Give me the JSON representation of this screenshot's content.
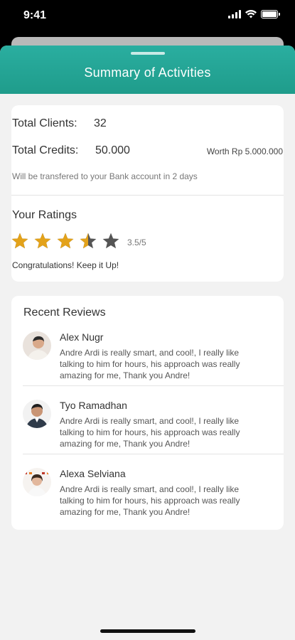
{
  "status_bar": {
    "time": "9:41"
  },
  "header": {
    "title": "Summary of Activities"
  },
  "summary": {
    "clients_label": "Total Clients:",
    "clients_value": "32",
    "credits_label": "Total Credits:",
    "credits_value": "50.000",
    "worth": "Worth Rp 5.000.000",
    "transfer_note": "Will be transfered to your Bank account in 2 days"
  },
  "ratings": {
    "title": "Your Ratings",
    "score": 3.5,
    "max": 5,
    "score_text": "3.5/5",
    "message": "Congratulations! Keep it Up!",
    "star_color": "#e3a21a",
    "star_empty_color": "#555555"
  },
  "reviews": {
    "title": "Recent Reviews",
    "items": [
      {
        "name": "Alex Nugr",
        "text": "Andre Ardi is really smart, and cool!, I really like talking to him for hours, his approach was really amazing for me, Thank you Andre!"
      },
      {
        "name": "Tyo Ramadhan",
        "text": "Andre Ardi is really smart, and cool!, I really like talking to him for hours, his approach was really amazing for me, Thank you Andre!"
      },
      {
        "name": "Alexa Selviana",
        "text": "Andre Ardi is really smart, and cool!, I really like talking to him for hours, his approach was really amazing for me, Thank you Andre!"
      }
    ]
  },
  "colors": {
    "accent": "#22a898",
    "background": "#f2f2f2"
  }
}
